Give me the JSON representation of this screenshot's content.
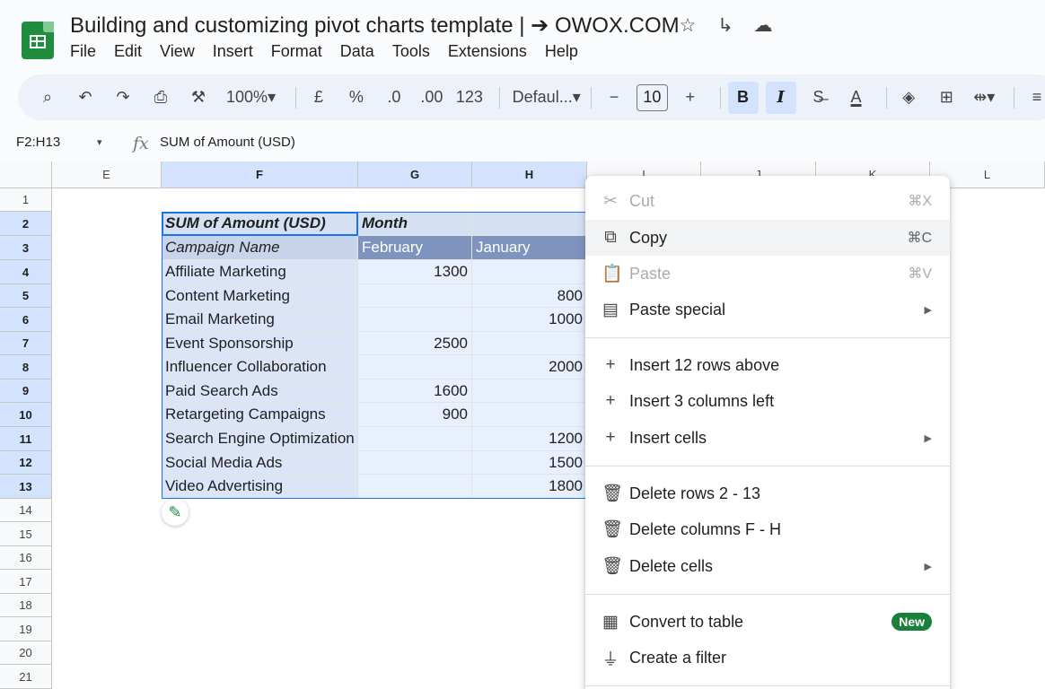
{
  "doc": {
    "title": "Building and customizing pivot charts template | ➔ OWOX.COM",
    "title_icons": [
      "☆",
      "↳",
      "☁"
    ]
  },
  "menus": [
    "File",
    "Edit",
    "View",
    "Insert",
    "Format",
    "Data",
    "Tools",
    "Extensions",
    "Help"
  ],
  "toolbar": {
    "zoom": "100%",
    "currency": "£",
    "percent": "%",
    "decrease_decimal": ".0",
    "increase_decimal": ".00",
    "number_format": "123",
    "font": "Defaul...",
    "font_size": "10",
    "bold": "B",
    "italic": "I",
    "text_color": "A"
  },
  "formula_bar": {
    "name_box": "F2:H13",
    "fx": "fx",
    "content": "SUM of Amount (USD)"
  },
  "columns": [
    "E",
    "F",
    "G",
    "H",
    "I",
    "J",
    "K",
    "L"
  ],
  "rows": [
    "1",
    "2",
    "3",
    "4",
    "5",
    "6",
    "7",
    "8",
    "9",
    "10",
    "11",
    "12",
    "13",
    "14",
    "15",
    "16",
    "17",
    "18",
    "19",
    "20",
    "21"
  ],
  "pivot": {
    "header_value": "SUM of Amount (USD)",
    "header_month": "Month",
    "row_label": "Campaign Name",
    "months": [
      "February",
      "January"
    ],
    "rows": [
      {
        "name": "Affiliate Marketing",
        "feb": "1300",
        "jan": ""
      },
      {
        "name": "Content Marketing",
        "feb": "",
        "jan": "800"
      },
      {
        "name": "Email Marketing",
        "feb": "",
        "jan": "1000"
      },
      {
        "name": "Event Sponsorship",
        "feb": "2500",
        "jan": ""
      },
      {
        "name": "Influencer Collaboration",
        "feb": "",
        "jan": "2000"
      },
      {
        "name": "Paid Search Ads",
        "feb": "1600",
        "jan": ""
      },
      {
        "name": "Retargeting Campaigns",
        "feb": "900",
        "jan": ""
      },
      {
        "name": "Search Engine Optimization",
        "feb": "",
        "jan": "1200"
      },
      {
        "name": "Social Media Ads",
        "feb": "",
        "jan": "1500"
      },
      {
        "name": "Video Advertising",
        "feb": "",
        "jan": "1800"
      }
    ]
  },
  "context_menu": {
    "cut": {
      "label": "Cut",
      "shortcut": "⌘X"
    },
    "copy": {
      "label": "Copy",
      "shortcut": "⌘C"
    },
    "paste": {
      "label": "Paste",
      "shortcut": "⌘V"
    },
    "paste_special": {
      "label": "Paste special"
    },
    "insert_rows": {
      "label": "Insert 12 rows above"
    },
    "insert_cols": {
      "label": "Insert 3 columns left"
    },
    "insert_cells": {
      "label": "Insert cells"
    },
    "delete_rows": {
      "label": "Delete rows 2 - 13"
    },
    "delete_cols": {
      "label": "Delete columns F - H"
    },
    "delete_cells": {
      "label": "Delete cells"
    },
    "convert_table": {
      "label": "Convert to table",
      "badge": "New"
    },
    "create_filter": {
      "label": "Create a filter"
    }
  }
}
